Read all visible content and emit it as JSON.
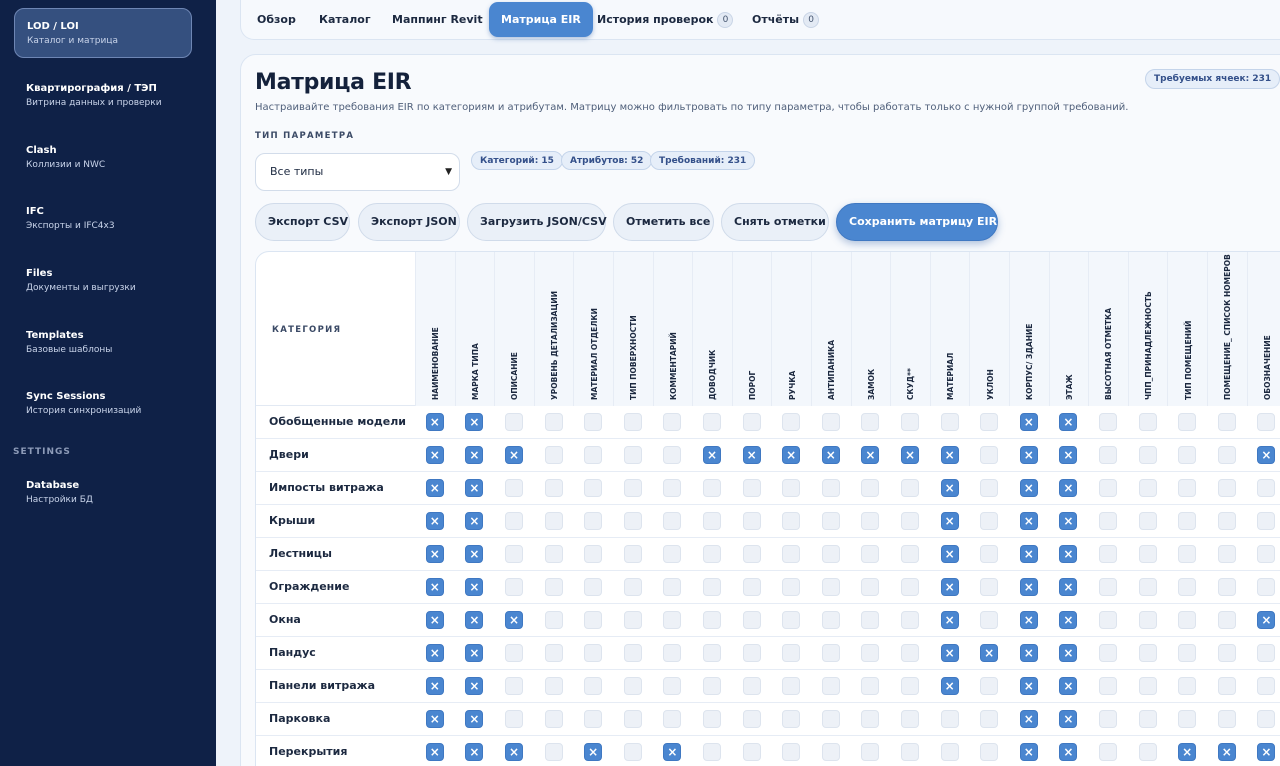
{
  "sidebar": {
    "items": [
      {
        "title": "LOD / LOI",
        "subtitle": "Каталог и матрица",
        "active": true
      },
      {
        "title": "Квартирография / ТЭП",
        "subtitle": "Витрина данных и проверки"
      },
      {
        "title": "Clash",
        "subtitle": "Коллизии и NWC"
      },
      {
        "title": "IFC",
        "subtitle": "Экспорты и IFC4x3"
      },
      {
        "title": "Files",
        "subtitle": "Документы и выгрузки"
      },
      {
        "title": "Templates",
        "subtitle": "Базовые шаблоны"
      },
      {
        "title": "Sync Sessions",
        "subtitle": "История синхронизаций"
      }
    ],
    "section_settings": "SETTINGS",
    "settings_items": [
      {
        "title": "Database",
        "subtitle": "Настройки БД"
      }
    ]
  },
  "nav": {
    "tabs": [
      {
        "label": "Обзор"
      },
      {
        "label": "Каталог"
      },
      {
        "label": "Маппинг Revit"
      },
      {
        "label": "Матрица EIR",
        "active": true
      },
      {
        "label": "История проверок",
        "count": "0"
      },
      {
        "label": "Отчёты",
        "count": "0"
      }
    ]
  },
  "main": {
    "title": "Матрица EIR",
    "description": "Настраивайте требования EIR по категориям и атрибутам. Матрицу можно фильтровать по типу параметра, чтобы работать только с нужной группой требований.",
    "required_cells_badge": "Требуемых ячеек: 231",
    "filter_label": "ТИП ПАРАМЕТРА",
    "filter_value": "Все типы",
    "stats": [
      "Категорий: 15",
      "Атрибутов: 52",
      "Требований: 231"
    ],
    "buttons": {
      "export_csv": "Экспорт CSV",
      "export_json": "Экспорт JSON",
      "load": "Загрузить JSON/CSV",
      "check_all": "Отметить все",
      "uncheck_all": "Снять отметки",
      "save": "Сохранить матрицу EIR"
    }
  },
  "matrix": {
    "category_header": "КАТЕГОРИЯ",
    "columns": [
      "Наименование",
      "Марка типа",
      "Описание",
      "Уровень детализации",
      "Материал отделки",
      "Тип поверхности",
      "Комментарий",
      "Доводчик",
      "Порог",
      "Ручка",
      "Антипаника",
      "Замок",
      "СКУД**",
      "Материал",
      "Уклон",
      "Корпус/ Здание",
      "Этаж",
      "Высотная отметка",
      "ЧПП_Принадлежность",
      "Тип помещений",
      "Помещение_ Список номеров",
      "Обозначение"
    ],
    "rows": [
      {
        "name": "Обобщенные модели",
        "checked": [
          0,
          1,
          15,
          16
        ]
      },
      {
        "name": "Двери",
        "checked": [
          0,
          1,
          2,
          7,
          8,
          9,
          10,
          11,
          12,
          13,
          15,
          16,
          21
        ]
      },
      {
        "name": "Импосты витража",
        "checked": [
          0,
          1,
          13,
          15,
          16
        ]
      },
      {
        "name": "Крыши",
        "checked": [
          0,
          1,
          13,
          15,
          16
        ]
      },
      {
        "name": "Лестницы",
        "checked": [
          0,
          1,
          13,
          15,
          16
        ]
      },
      {
        "name": "Ограждение",
        "checked": [
          0,
          1,
          13,
          15,
          16
        ]
      },
      {
        "name": "Окна",
        "checked": [
          0,
          1,
          2,
          13,
          15,
          16,
          21
        ]
      },
      {
        "name": "Пандус",
        "checked": [
          0,
          1,
          13,
          14,
          15,
          16
        ]
      },
      {
        "name": "Панели витража",
        "checked": [
          0,
          1,
          13,
          15,
          16
        ]
      },
      {
        "name": "Парковка",
        "checked": [
          0,
          1,
          15,
          16
        ]
      },
      {
        "name": "Перекрытия",
        "checked": [
          0,
          1,
          2,
          4,
          6,
          15,
          16,
          19,
          20,
          21
        ]
      }
    ]
  }
}
